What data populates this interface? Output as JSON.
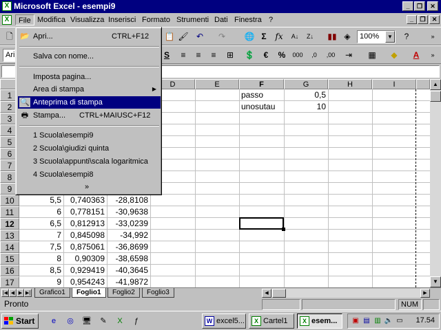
{
  "window": {
    "title": "Microsoft Excel - esempi9",
    "app_icon": "excel-icon"
  },
  "menubar": {
    "items": [
      "File",
      "Modifica",
      "Visualizza",
      "Inserisci",
      "Formato",
      "Strumenti",
      "Dati",
      "Finestra",
      "?"
    ]
  },
  "toolbar": {
    "zoom": "100%",
    "font_name": "Ari"
  },
  "file_menu": {
    "items": [
      {
        "label": "Apri...",
        "shortcut": "CTRL+F12"
      },
      {
        "label": "Salva con nome..."
      },
      {
        "label": "Imposta pagina..."
      },
      {
        "label": "Area di stampa"
      },
      {
        "label": "Anteprima di stampa"
      },
      {
        "label": "Stampa...",
        "shortcut": "CTRL+MAIUSC+F12"
      },
      {
        "label": "1 Scuola\\esempi9"
      },
      {
        "label": "2 Scuola\\giudizi quinta"
      },
      {
        "label": "3 Scuola\\appunti\\scala logaritmica"
      },
      {
        "label": "4 Scuola\\esempi8"
      }
    ],
    "highlighted": "Anteprima di stampa",
    "more": "»"
  },
  "sheet": {
    "columns": [
      "D",
      "E",
      "F",
      "G",
      "H",
      "I"
    ],
    "rows": [
      "1",
      "2",
      "3",
      "4",
      "5",
      "6",
      "7",
      "8",
      "9",
      "10",
      "11",
      "12",
      "13",
      "14",
      "15",
      "16",
      "17"
    ],
    "selected_row": "12",
    "selected_column": "F",
    "labels": {
      "passo": "passo",
      "unosutau": "unosutau"
    },
    "params": {
      "passo": "0,5",
      "unosutau": "10"
    },
    "data": [
      [
        "5,5",
        "0,740363",
        "-28,8108"
      ],
      [
        "6",
        "0,778151",
        "-30,9638"
      ],
      [
        "6,5",
        "0,812913",
        "-33,0239"
      ],
      [
        "7",
        "0,845098",
        "-34,992"
      ],
      [
        "7,5",
        "0,875061",
        "-36,8699"
      ],
      [
        "8",
        "0,90309",
        "-38,6598"
      ],
      [
        "8,5",
        "0,929419",
        "-40,3645"
      ],
      [
        "9",
        "0,954243",
        "-41,9872"
      ]
    ]
  },
  "sheet_tabs": [
    "Grafico1",
    "Foglio1",
    "Foglio2",
    "Foglio3"
  ],
  "active_tab": "Foglio1",
  "status": {
    "text": "Pronto",
    "num": "NUM"
  },
  "taskbar": {
    "start": "Start",
    "tasks": [
      "excel5...",
      "Cartel1",
      "esem..."
    ],
    "active_task": "esem...",
    "clock": "17.54"
  }
}
